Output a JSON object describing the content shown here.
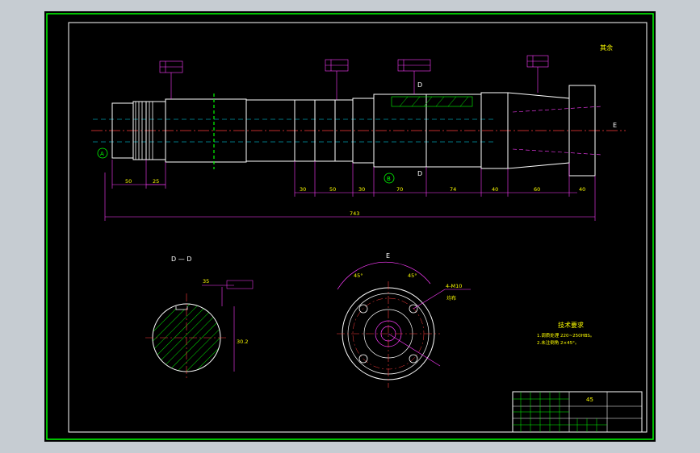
{
  "drawing": {
    "corner_mark": "其余",
    "section_dd": {
      "title": "D — D",
      "dim_left": "35",
      "dim_height": "30.2"
    },
    "view_e": {
      "title": "E",
      "hole_note": "4-M10",
      "angle_a": "45°",
      "angle_b": "45°",
      "circle_note": "均布"
    },
    "tech_req": {
      "title": "技术要求",
      "line1": "1.调质处理 220~250HBS。",
      "line2": "2.未注倒角 2×45°。"
    },
    "shaft_dims": {
      "d1": "50",
      "d2": "25",
      "d3": "30",
      "d4": "50",
      "d5": "30",
      "d6": "70",
      "d7": "74",
      "d8": "40",
      "d9": "60",
      "d10": "40",
      "total": "743"
    },
    "labels": {
      "section_d_top": "D",
      "section_d_bottom": "D",
      "view_a": "A",
      "view_b": "B",
      "view_e_arrow": "E"
    },
    "title_block": {
      "material": "45"
    }
  },
  "colors": {
    "line": "#ffffff",
    "dim": "#ff3cff",
    "center": "#00e5ff",
    "text": "#ffff00",
    "hatch": "#00ff00",
    "border": "#00ff00"
  }
}
